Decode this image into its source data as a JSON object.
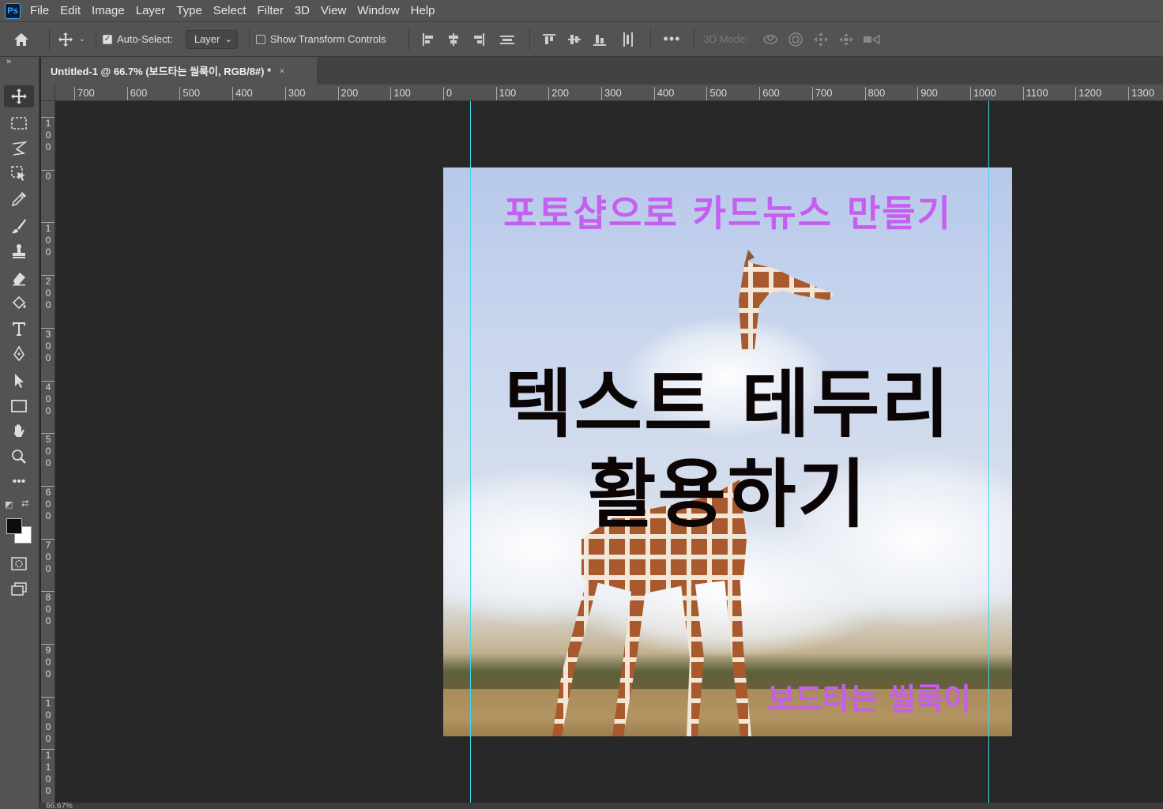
{
  "app": {
    "logo": "Ps"
  },
  "menu": [
    "File",
    "Edit",
    "Image",
    "Layer",
    "Type",
    "Select",
    "Filter",
    "3D",
    "View",
    "Window",
    "Help"
  ],
  "options": {
    "auto_select_label": "Auto-Select:",
    "auto_select_checked": true,
    "layer_select_value": "Layer",
    "show_transform_label": "Show Transform Controls",
    "show_transform_checked": false,
    "mode_3d_label": "3D Mode:"
  },
  "document_tab": {
    "title": "Untitled-1 @ 66.7% (보드타는 씰룩이, RGB/8#) *",
    "close": "×"
  },
  "ruler": {
    "horizontal": [
      "700",
      "600",
      "500",
      "400",
      "300",
      "200",
      "100",
      "0",
      "100",
      "200",
      "300",
      "400",
      "500",
      "600",
      "700",
      "800",
      "900",
      "1000",
      "1100",
      "1200",
      "1300"
    ],
    "vertical": [
      "100",
      "0",
      "100",
      "200",
      "300",
      "400",
      "500",
      "600",
      "700",
      "800",
      "900",
      "1000",
      "1100"
    ]
  },
  "canvas": {
    "top_title": "포토샵으로 카드뉴스 만들기",
    "main_line1": "텍스트 테두리",
    "main_line2": "활용하기",
    "credit": "보드타는 씰룩이"
  },
  "colors": {
    "accent_purple": "#c65ef0",
    "main_text": "#0c0506",
    "guide": "#3fd7e8",
    "foreground": "#0d0d0d",
    "background": "#ffffff"
  },
  "status": {
    "zoom": "66.67%"
  }
}
